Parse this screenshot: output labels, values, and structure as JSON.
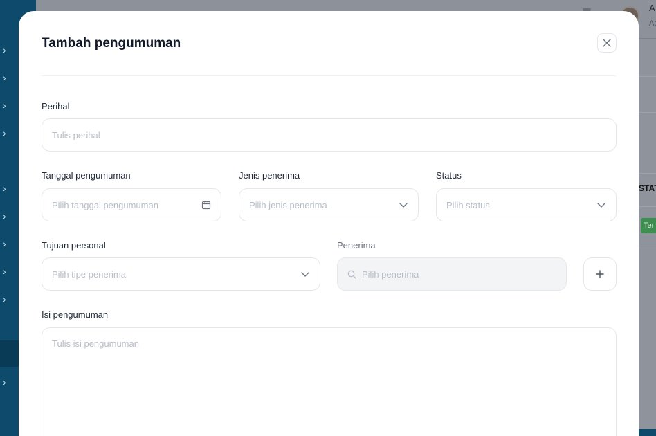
{
  "modal": {
    "title": "Tambah pengumuman"
  },
  "form": {
    "perihal": {
      "label": "Perihal",
      "placeholder": "Tulis perihal"
    },
    "tanggal": {
      "label": "Tanggal pengumuman",
      "placeholder": "Pilih tanggal pengumuman"
    },
    "jenis": {
      "label": "Jenis penerima",
      "placeholder": "Pilih jenis penerima"
    },
    "status": {
      "label": "Status",
      "placeholder": "Pilih status"
    },
    "tujuan": {
      "label": "Tujuan personal",
      "placeholder": "Pilih tipe penerima"
    },
    "penerima": {
      "label": "Penerima",
      "placeholder": "Pilih penerima"
    },
    "isi": {
      "label": "Isi pengumuman",
      "placeholder": "Tulis isi pengumuman"
    }
  },
  "background": {
    "user_initial": "A",
    "user_sub": "Ad",
    "column_header": "STAT",
    "tag_label": "Ter"
  },
  "colors": {
    "sidebar": "#0d4a6b",
    "overlay": "#8d9199",
    "modal_bg": "#ffffff",
    "placeholder": "#b8bec7",
    "tag_green": "#3e8e52"
  }
}
